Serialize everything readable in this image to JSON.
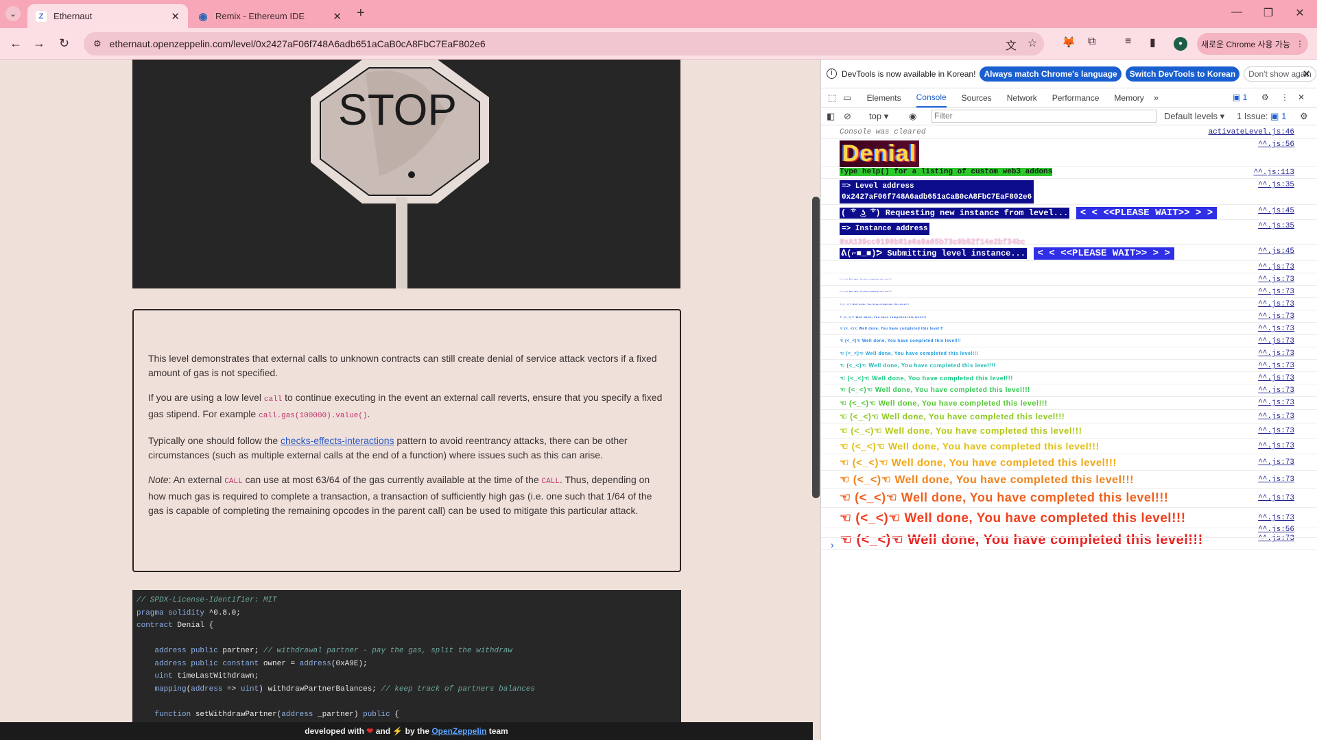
{
  "browser": {
    "tabs": [
      {
        "title": "Ethernaut",
        "favicon": "Z",
        "active": true
      },
      {
        "title": "Remix - Ethereum IDE",
        "favicon": "remix-logo",
        "active": false
      }
    ],
    "url": "ethernaut.openzeppelin.com/level/0x2427aF06f748A6adb651aCaB0cA8FbC7EaF802e6",
    "upgrade_label": "새로운 Chrome 사용 가능",
    "profile_initial": "●"
  },
  "page": {
    "image_text": "STOP",
    "paragraphs": {
      "p1": "This level demonstrates that external calls to unknown contracts can still create denial of service attack vectors if a fixed amount of gas is not specified.",
      "p2_a": "If you are using a low level ",
      "p2_code1": "call",
      "p2_b": " to continue executing in the event an external call reverts, ensure that you specify a fixed gas stipend. For example ",
      "p2_code2": "call.gas(100000).value()",
      "p2_c": ".",
      "p3_a": "Typically one should follow the ",
      "p3_link": "checks-effects-interactions",
      "p3_b": " pattern to avoid reentrancy attacks, there can be other circumstances (such as multiple external calls at the end of a function) where issues such as this can arise.",
      "p4_em": "Note",
      "p4_a": ": An external ",
      "p4_code1": "CALL",
      "p4_b": " can use at most 63/64 of the gas currently available at the time of the ",
      "p4_code2": "CALL",
      "p4_c": ". Thus, depending on how much gas is required to complete a transaction, a transaction of sufficiently high gas (i.e. one such that 1/64 of the gas is capable of completing the remaining opcodes in the parent call) can be used to mitigate this particular attack."
    },
    "code": {
      "l1": "// SPDX-License-Identifier: MIT",
      "l2_kw": "pragma solidity",
      "l2_rest": " ^0.8.0;",
      "l3_kw": "contract",
      "l3_rest": " Denial {",
      "l5_kw": "address public",
      "l5_rest": " partner; ",
      "l5_comment": "// withdrawal partner - pay the gas, split the withdraw",
      "l6_kw": "address public constant",
      "l6_rest": " owner = ",
      "l6_kw2": "address",
      "l6_rest2": "(0xA9E);",
      "l7_kw": "uint",
      "l7_rest": " timeLastWithdrawn;",
      "l8_kw": "mapping",
      "l8_rest_a": "(",
      "l8_kw2": "address",
      "l8_rest_b": " => ",
      "l8_kw3": "uint",
      "l8_rest_c": ") withdrawPartnerBalances; ",
      "l8_comment": "// keep track of partners balances",
      "l10_kw": "function",
      "l10_rest": " setWithdrawPartner(",
      "l10_kw2": "address",
      "l10_rest2": " _partner) ",
      "l10_kw3": "public",
      "l10_rest3": " {"
    },
    "footer": {
      "pre": "developed with ",
      "mid": " and ",
      "by": " by the ",
      "link": "OpenZeppelin",
      "post": " team"
    }
  },
  "devtools": {
    "notice": {
      "text": "DevTools is now available in Korean!",
      "btn_match": "Always match Chrome's language",
      "btn_switch": "Switch DevTools to Korean",
      "btn_dismiss": "Don't show again"
    },
    "tabs": [
      "Elements",
      "Console",
      "Sources",
      "Network",
      "Performance",
      "Memory"
    ],
    "active_tab": "Console",
    "messages_badge": "1",
    "context": "top",
    "filter_placeholder": "Filter",
    "levels": "Default levels",
    "issues": "1 Issue:",
    "issues_count": "1",
    "console": {
      "cleared": "Console was cleared",
      "cleared_src": "activateLevel.js:46",
      "denial": "Denial",
      "help": "Type help() for a listing of custom web3 addons",
      "level_label": "=> Level address",
      "level_address": "0x2427aF06f748A6adb651aCaB0cA8FbC7EaF802e6",
      "requesting": "( ͡° ͜ʖ ͡°) Requesting new instance from level...",
      "please_wait": "<  < <<PLEASE WAIT>> >  >",
      "instance_label": "=> Instance address",
      "instance_address": "0xA139cc0190b61e0a9a05b73c9b52f14e2bf34bc",
      "submitting": "ᕕ(⌐■_■)ᕗ Submitting level instance...",
      "done": "☜ (<_<)☜ Well done, You have completed this level!!!",
      "src_56": "^^.js:56",
      "src_113": "^^.js:113",
      "src_35": "^^.js:35",
      "src_45": "^^.js:45",
      "src_73": "^^.js:73"
    },
    "rainbow_colors": [
      "#1a2adb",
      "#1a2adb",
      "#1a2adb",
      "#1a40e0",
      "#1a55e0",
      "#1a6ae6",
      "#1a80e6",
      "#1aa0e0",
      "#18b8b0",
      "#1ac880",
      "#2ec850",
      "#58c832",
      "#8cc81e",
      "#b4c814",
      "#e0c010",
      "#f0a814",
      "#f08018",
      "#f0601c",
      "#f0401e",
      "#e82424"
    ]
  }
}
